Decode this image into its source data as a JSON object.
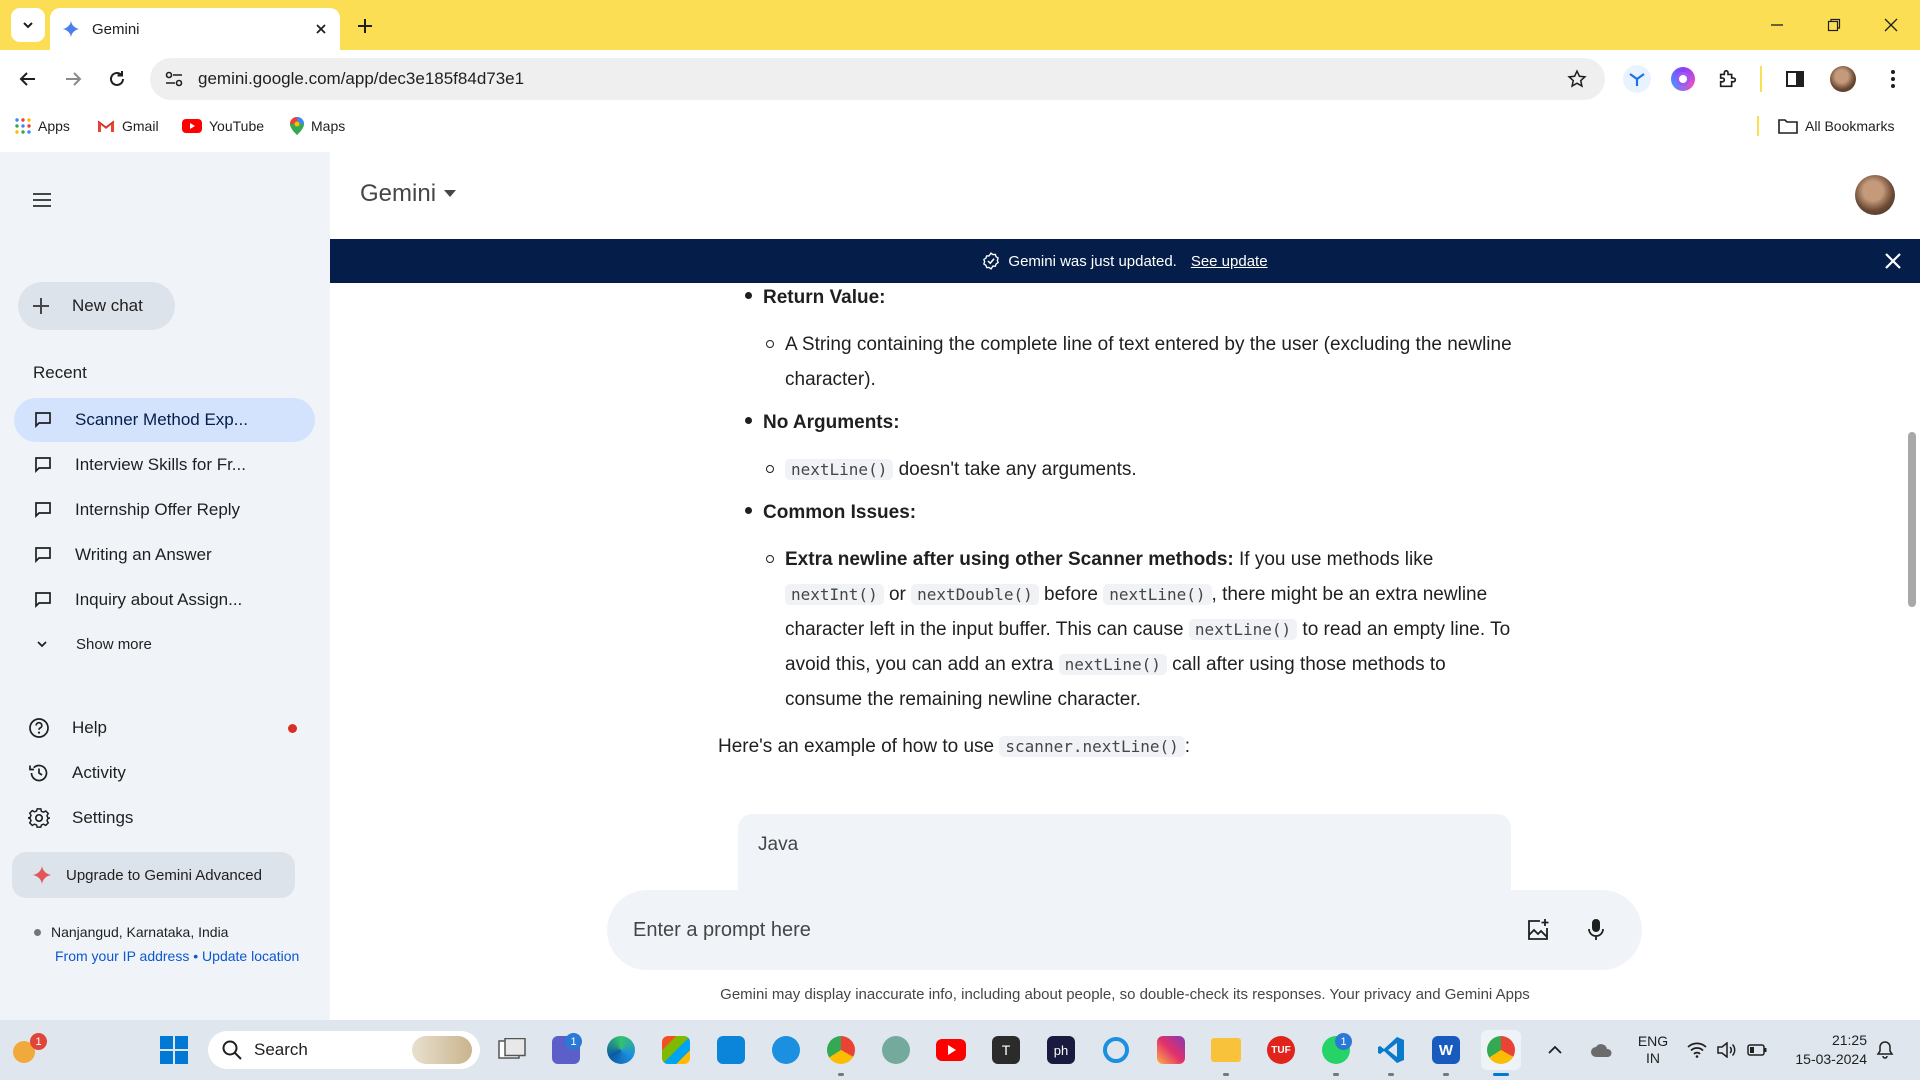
{
  "browser": {
    "tab_title": "Gemini",
    "url": "gemini.google.com/app/dec3e185f84d73e1",
    "bookmarks": [
      "Apps",
      "Gmail",
      "YouTube",
      "Maps"
    ],
    "all_bookmarks": "All Bookmarks"
  },
  "sidebar": {
    "new_chat": "New chat",
    "recent_heading": "Recent",
    "recent": [
      {
        "label": "Scanner Method Exp..."
      },
      {
        "label": "Interview Skills for Fr..."
      },
      {
        "label": "Internship Offer Reply"
      },
      {
        "label": "Writing an Answer"
      },
      {
        "label": "Inquiry about Assign..."
      }
    ],
    "show_more": "Show more",
    "help": "Help",
    "activity": "Activity",
    "settings": "Settings",
    "upgrade": "Upgrade to Gemini Advanced",
    "location": "Nanjangud, Karnataka, India",
    "location_source": "From your IP address",
    "location_sep": " • ",
    "update_location": "Update location"
  },
  "header": {
    "brand": "Gemini"
  },
  "banner": {
    "text": "Gemini was just updated.",
    "link": "See update"
  },
  "content": {
    "return_value_heading": "Return Value:",
    "return_value_text": "A String containing the complete line of text entered by the user (excluding the newline character).",
    "no_args_heading": "No Arguments:",
    "no_args_code": "nextLine()",
    "no_args_text": " doesn't take any arguments.",
    "issues_heading": "Common Issues:",
    "issue_title": "Extra newline after using other Scanner methods:",
    "issue_t1": " If you use methods like ",
    "issue_c1": "nextInt()",
    "issue_t2": " or ",
    "issue_c2": "nextDouble()",
    "issue_t3": " before ",
    "issue_c3": "nextLine()",
    "issue_t4": ", there might be an extra newline character left in the input buffer. This can cause ",
    "issue_c4": "nextLine()",
    "issue_t5": " to read an empty line. To avoid this, you can add an extra ",
    "issue_c5": "nextLine()",
    "issue_t6": " call after using those methods to consume the remaining newline character.",
    "example_text": "Here's an example of how to use ",
    "example_code": "scanner.nextLine()",
    "example_end": ":",
    "code_lang": "Java"
  },
  "prompt": {
    "placeholder": "Enter a prompt here"
  },
  "disclaimer": "Gemini may display inaccurate info, including about people, so double-check its responses. Your privacy and Gemini Apps",
  "taskbar": {
    "search": "Search",
    "lang1": "ENG",
    "lang2": "IN",
    "time": "21:25",
    "date": "15-03-2024",
    "notif_count": "1",
    "teams_badge": "1",
    "whatsapp_badge": "1",
    "t_label": "T",
    "tuf_label": "TUF",
    "ph_label": "ph"
  },
  "colors": {
    "titlebar": "#fbde53",
    "banner": "#041e49",
    "sidebar_bg": "#f0f4f9",
    "active_chat": "#d3e3fd",
    "help_dot": "#d93025"
  }
}
